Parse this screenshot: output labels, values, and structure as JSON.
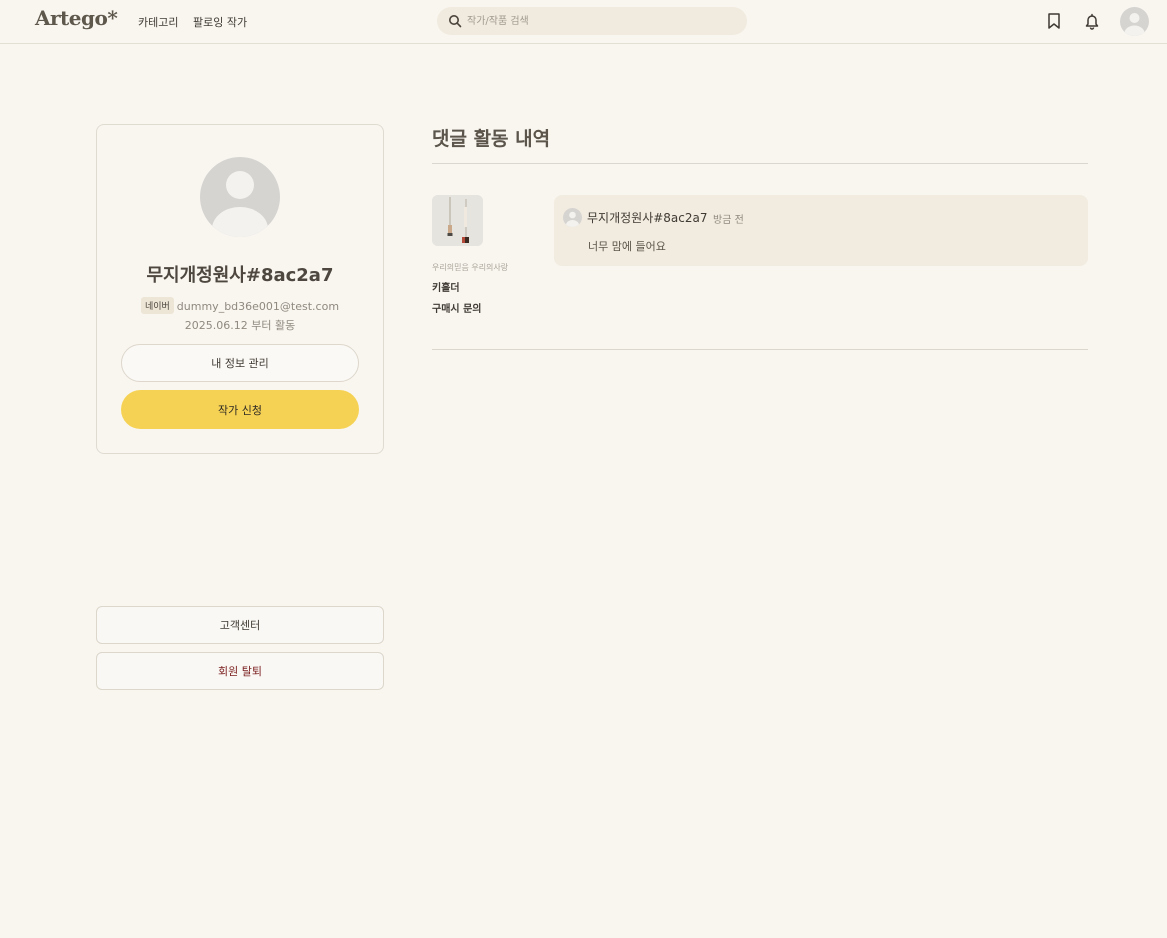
{
  "header": {
    "logo": "Artego*",
    "nav": {
      "category": "카테고리",
      "following": "팔로잉 작가"
    },
    "search": {
      "placeholder": "작가/작품 검색",
      "value": ""
    },
    "icons": {
      "search": "search-icon",
      "bookmark": "bookmark-icon",
      "notification": "bell-icon",
      "avatar": "user-avatar"
    }
  },
  "profile": {
    "name": "무지개정원사#8ac2a7",
    "provider": "네이버",
    "email": "dummy_bd36e001@test.com",
    "since": "2025.06.12 부터 활동",
    "manage_label": "내 정보 관리",
    "apply_label": "작가 신청"
  },
  "sidebar": {
    "support_label": "고객센터",
    "withdraw_label": "회원 탈퇴"
  },
  "main": {
    "title": "댓글 활동 내역",
    "comments": [
      {
        "artist": "우리의믿음 우리의사랑",
        "artwork_title": "키홀더",
        "artwork_status": "구매시 문의",
        "author": "무지개정원사#8ac2a7",
        "time": "방금 전",
        "text": "너무 맘에 들어요"
      }
    ]
  },
  "colors": {
    "background": "#f9f6f0",
    "accent_yellow": "#f6d254",
    "comment_bg": "#f2ece0",
    "danger_text": "#7a1f1f"
  }
}
